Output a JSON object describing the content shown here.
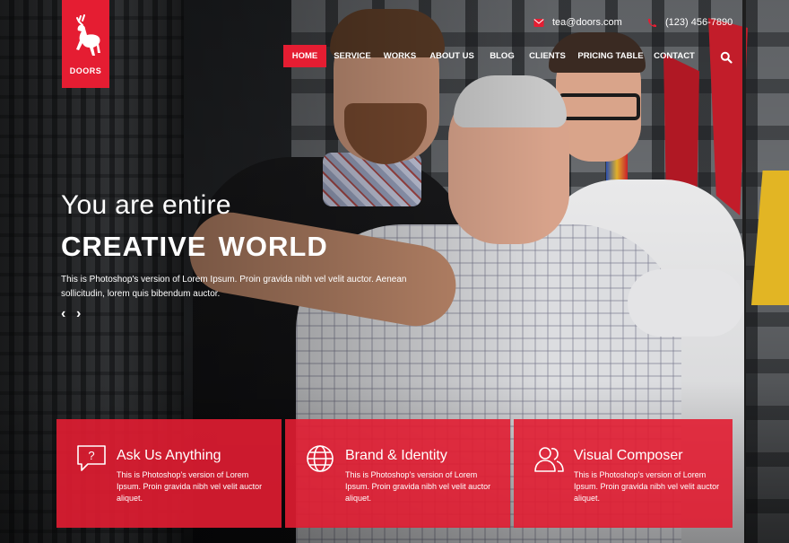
{
  "brand": {
    "name": "DOORS",
    "accent": "#e51d32"
  },
  "contact": {
    "email": "tea@doors.com",
    "phone": "(123) 456-7890",
    "email_icon": "envelope-icon",
    "phone_icon": "phone-icon"
  },
  "nav": {
    "items": [
      {
        "label": "HOME",
        "active": true
      },
      {
        "label": "SERVICE"
      },
      {
        "label": "WORKS"
      },
      {
        "label": "ABOUT US"
      },
      {
        "label": "BLOG"
      },
      {
        "label": "CLIENTS"
      },
      {
        "label": "PRICING TABLE"
      },
      {
        "label": "CONTACT"
      }
    ],
    "search_icon": "search-icon"
  },
  "hero": {
    "subtitle": "You are entire",
    "title": "creative world",
    "description": "This is Photoshop's version of Lorem Ipsum. Proin gravida nibh vel velit auctor. Aenean sollicitudin, lorem quis bibendum auctor.",
    "prev_arrow": "‹",
    "next_arrow": "›"
  },
  "features": [
    {
      "title": "Ask Us Anything",
      "icon": "question-chat-icon",
      "description": "This is Photoshop's version of Lorem Ipsum. Proin gravida nibh vel velit auctor aliquet."
    },
    {
      "title": "Brand & Identity",
      "icon": "globe-icon",
      "description": "This is Photoshop's version of Lorem Ipsum. Proin gravida nibh vel velit auctor aliquet."
    },
    {
      "title": "Visual Composer",
      "icon": "users-icon",
      "description": "This is Photoshop's version of Lorem Ipsum. Proin gravida nibh vel velit auctor aliquet."
    }
  ]
}
